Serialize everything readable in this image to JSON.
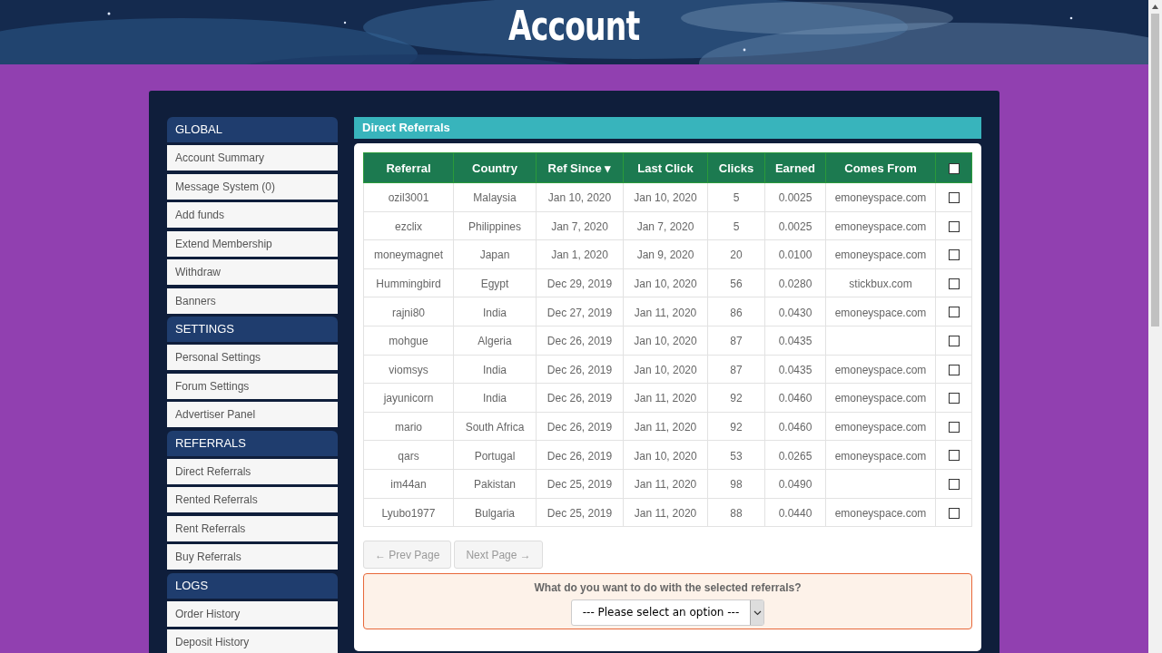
{
  "header": {
    "title": "Account"
  },
  "sidebar": [
    {
      "heading": "GLOBAL",
      "items": [
        "Account Summary",
        "Message System (0)",
        "Add funds",
        "Extend Membership",
        "Withdraw",
        "Banners"
      ]
    },
    {
      "heading": "SETTINGS",
      "items": [
        "Personal Settings",
        "Forum Settings",
        "Advertiser Panel"
      ]
    },
    {
      "heading": "REFERRALS",
      "items": [
        "Direct Referrals",
        "Rented Referrals",
        "Rent Referrals",
        "Buy Referrals"
      ]
    },
    {
      "heading": "LOGS",
      "items": [
        "Order History",
        "Deposit History"
      ]
    }
  ],
  "panel": {
    "title": "Direct Referrals"
  },
  "table": {
    "columns": [
      {
        "label": "Referral"
      },
      {
        "label": "Country"
      },
      {
        "label": "Ref Since",
        "sort_arrow": "▾"
      },
      {
        "label": "Last Click"
      },
      {
        "label": "Clicks"
      },
      {
        "label": "Earned"
      },
      {
        "label": "Comes From"
      }
    ],
    "select_all_checked": false,
    "rows": [
      {
        "referral": "ozil3001",
        "country": "Malaysia",
        "ref_since": "Jan 10, 2020",
        "last_click": "Jan 10, 2020",
        "clicks": "5",
        "earned": "0.0025",
        "comes_from": "emoneyspace.com",
        "checked": false
      },
      {
        "referral": "ezclix",
        "country": "Philippines",
        "ref_since": "Jan 7, 2020",
        "last_click": "Jan 7, 2020",
        "clicks": "5",
        "earned": "0.0025",
        "comes_from": "emoneyspace.com",
        "checked": false
      },
      {
        "referral": "moneymagnet",
        "country": "Japan",
        "ref_since": "Jan 1, 2020",
        "last_click": "Jan 9, 2020",
        "clicks": "20",
        "earned": "0.0100",
        "comes_from": "emoneyspace.com",
        "checked": false
      },
      {
        "referral": "Hummingbird",
        "country": "Egypt",
        "ref_since": "Dec 29, 2019",
        "last_click": "Jan 10, 2020",
        "clicks": "56",
        "earned": "0.0280",
        "comes_from": "stickbux.com",
        "checked": false
      },
      {
        "referral": "rajni80",
        "country": "India",
        "ref_since": "Dec 27, 2019",
        "last_click": "Jan 11, 2020",
        "clicks": "86",
        "earned": "0.0430",
        "comes_from": "emoneyspace.com",
        "checked": false
      },
      {
        "referral": "mohgue",
        "country": "Algeria",
        "ref_since": "Dec 26, 2019",
        "last_click": "Jan 10, 2020",
        "clicks": "87",
        "earned": "0.0435",
        "checked": false
      },
      {
        "referral": "viomsys",
        "country": "India",
        "ref_since": "Dec 26, 2019",
        "last_click": "Jan 10, 2020",
        "clicks": "87",
        "earned": "0.0435",
        "comes_from": "emoneyspace.com",
        "checked": false
      },
      {
        "referral": "jayunicorn",
        "country": "India",
        "ref_since": "Dec 26, 2019",
        "last_click": "Jan 11, 2020",
        "clicks": "92",
        "earned": "0.0460",
        "comes_from": "emoneyspace.com",
        "checked": false
      },
      {
        "referral": "mario",
        "country": "South Africa",
        "ref_since": "Dec 26, 2019",
        "last_click": "Jan 11, 2020",
        "clicks": "92",
        "earned": "0.0460",
        "comes_from": "emoneyspace.com",
        "checked": false
      },
      {
        "referral": "qars",
        "country": "Portugal",
        "ref_since": "Dec 26, 2019",
        "last_click": "Jan 10, 2020",
        "clicks": "53",
        "earned": "0.0265",
        "comes_from": "emoneyspace.com",
        "checked": false
      },
      {
        "referral": "im44an",
        "country": "Pakistan",
        "ref_since": "Dec 25, 2019",
        "last_click": "Jan 11, 2020",
        "clicks": "98",
        "earned": "0.0490",
        "checked": false
      },
      {
        "referral": "Lyubo1977",
        "country": "Bulgaria",
        "ref_since": "Dec 25, 2019",
        "last_click": "Jan 11, 2020",
        "clicks": "88",
        "earned": "0.0440",
        "comes_from": "emoneyspace.com",
        "checked": false
      }
    ]
  },
  "pagination": [
    {
      "label": "← Prev Page",
      "disabled": true
    },
    {
      "label": "Next Page →",
      "disabled": true
    }
  ],
  "action_box": {
    "question": "What do you want to do with the selected referrals?",
    "select_value": "--- Please select an option ---"
  }
}
